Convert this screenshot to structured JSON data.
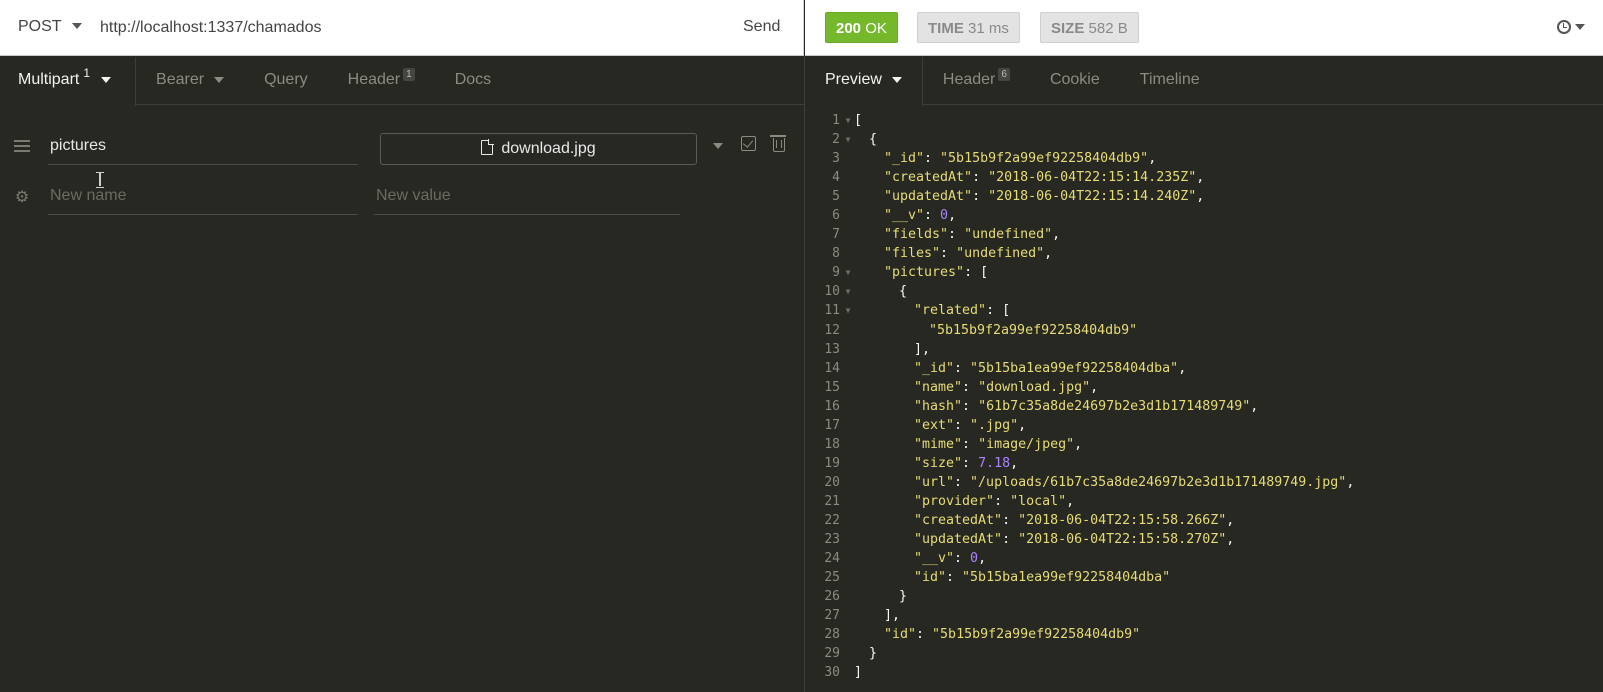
{
  "request": {
    "method": "POST",
    "url": "http://localhost:1337/chamados",
    "send_label": "Send"
  },
  "response_status": {
    "status_code": "200",
    "status_text": "OK",
    "time_label": "TIME",
    "time_value": "31 ms",
    "size_label": "SIZE",
    "size_value": "582 B"
  },
  "left_tabs": [
    {
      "label": "Multipart",
      "badge": "1",
      "active": true
    },
    {
      "label": "Bearer",
      "badge": "",
      "active": false
    },
    {
      "label": "Query",
      "badge": "",
      "active": false
    },
    {
      "label": "Header",
      "badge": "1",
      "active": false
    },
    {
      "label": "Docs",
      "badge": "",
      "active": false
    }
  ],
  "right_tabs": [
    {
      "label": "Preview",
      "badge": "",
      "active": true
    },
    {
      "label": "Header",
      "badge": "6",
      "active": false
    },
    {
      "label": "Cookie",
      "badge": "",
      "active": false
    },
    {
      "label": "Timeline",
      "badge": "",
      "active": false
    }
  ],
  "multipart": {
    "field_name": "pictures",
    "file_name": "download.jpg",
    "new_name_placeholder": "New name",
    "new_value_placeholder": "New value"
  },
  "colors": {
    "ok_green": "#75b82c",
    "editor_bg": "#272822",
    "json_string": "#e6db74",
    "json_number": "#ae81ff"
  },
  "response_lines": [
    {
      "n": "1",
      "fold": true,
      "indent": 0,
      "parts": [
        [
          "p",
          "["
        ]
      ]
    },
    {
      "n": "2",
      "fold": true,
      "indent": 1,
      "parts": [
        [
          "p",
          "{"
        ]
      ]
    },
    {
      "n": "3",
      "fold": false,
      "indent": 2,
      "parts": [
        [
          "k",
          "\"_id\""
        ],
        [
          "p",
          ": "
        ],
        [
          "s",
          "\"5b15b9f2a99ef92258404db9\""
        ],
        [
          "p",
          ","
        ]
      ]
    },
    {
      "n": "4",
      "fold": false,
      "indent": 2,
      "parts": [
        [
          "k",
          "\"createdAt\""
        ],
        [
          "p",
          ": "
        ],
        [
          "s",
          "\"2018-06-04T22:15:14.235Z\""
        ],
        [
          "p",
          ","
        ]
      ]
    },
    {
      "n": "5",
      "fold": false,
      "indent": 2,
      "parts": [
        [
          "k",
          "\"updatedAt\""
        ],
        [
          "p",
          ": "
        ],
        [
          "s",
          "\"2018-06-04T22:15:14.240Z\""
        ],
        [
          "p",
          ","
        ]
      ]
    },
    {
      "n": "6",
      "fold": false,
      "indent": 2,
      "parts": [
        [
          "k",
          "\"__v\""
        ],
        [
          "p",
          ": "
        ],
        [
          "n",
          "0"
        ],
        [
          "p",
          ","
        ]
      ]
    },
    {
      "n": "7",
      "fold": false,
      "indent": 2,
      "parts": [
        [
          "k",
          "\"fields\""
        ],
        [
          "p",
          ": "
        ],
        [
          "s",
          "\"undefined\""
        ],
        [
          "p",
          ","
        ]
      ]
    },
    {
      "n": "8",
      "fold": false,
      "indent": 2,
      "parts": [
        [
          "k",
          "\"files\""
        ],
        [
          "p",
          ": "
        ],
        [
          "s",
          "\"undefined\""
        ],
        [
          "p",
          ","
        ]
      ]
    },
    {
      "n": "9",
      "fold": true,
      "indent": 2,
      "parts": [
        [
          "k",
          "\"pictures\""
        ],
        [
          "p",
          ": ["
        ]
      ]
    },
    {
      "n": "10",
      "fold": true,
      "indent": 3,
      "parts": [
        [
          "p",
          "{"
        ]
      ]
    },
    {
      "n": "11",
      "fold": true,
      "indent": 4,
      "parts": [
        [
          "k",
          "\"related\""
        ],
        [
          "p",
          ": ["
        ]
      ]
    },
    {
      "n": "12",
      "fold": false,
      "indent": 5,
      "parts": [
        [
          "s",
          "\"5b15b9f2a99ef92258404db9\""
        ]
      ]
    },
    {
      "n": "13",
      "fold": false,
      "indent": 4,
      "parts": [
        [
          "p",
          "],"
        ]
      ]
    },
    {
      "n": "14",
      "fold": false,
      "indent": 4,
      "parts": [
        [
          "k",
          "\"_id\""
        ],
        [
          "p",
          ": "
        ],
        [
          "s",
          "\"5b15ba1ea99ef92258404dba\""
        ],
        [
          "p",
          ","
        ]
      ]
    },
    {
      "n": "15",
      "fold": false,
      "indent": 4,
      "parts": [
        [
          "k",
          "\"name\""
        ],
        [
          "p",
          ": "
        ],
        [
          "s",
          "\"download.jpg\""
        ],
        [
          "p",
          ","
        ]
      ]
    },
    {
      "n": "16",
      "fold": false,
      "indent": 4,
      "parts": [
        [
          "k",
          "\"hash\""
        ],
        [
          "p",
          ": "
        ],
        [
          "s",
          "\"61b7c35a8de24697b2e3d1b171489749\""
        ],
        [
          "p",
          ","
        ]
      ]
    },
    {
      "n": "17",
      "fold": false,
      "indent": 4,
      "parts": [
        [
          "k",
          "\"ext\""
        ],
        [
          "p",
          ": "
        ],
        [
          "s",
          "\".jpg\""
        ],
        [
          "p",
          ","
        ]
      ]
    },
    {
      "n": "18",
      "fold": false,
      "indent": 4,
      "parts": [
        [
          "k",
          "\"mime\""
        ],
        [
          "p",
          ": "
        ],
        [
          "s",
          "\"image/jpeg\""
        ],
        [
          "p",
          ","
        ]
      ]
    },
    {
      "n": "19",
      "fold": false,
      "indent": 4,
      "parts": [
        [
          "k",
          "\"size\""
        ],
        [
          "p",
          ": "
        ],
        [
          "n",
          "7.18"
        ],
        [
          "p",
          ","
        ]
      ]
    },
    {
      "n": "20",
      "fold": false,
      "indent": 4,
      "parts": [
        [
          "k",
          "\"url\""
        ],
        [
          "p",
          ": "
        ],
        [
          "s",
          "\"/uploads/61b7c35a8de24697b2e3d1b171489749.jpg\""
        ],
        [
          "p",
          ","
        ]
      ]
    },
    {
      "n": "21",
      "fold": false,
      "indent": 4,
      "parts": [
        [
          "k",
          "\"provider\""
        ],
        [
          "p",
          ": "
        ],
        [
          "s",
          "\"local\""
        ],
        [
          "p",
          ","
        ]
      ]
    },
    {
      "n": "22",
      "fold": false,
      "indent": 4,
      "parts": [
        [
          "k",
          "\"createdAt\""
        ],
        [
          "p",
          ": "
        ],
        [
          "s",
          "\"2018-06-04T22:15:58.266Z\""
        ],
        [
          "p",
          ","
        ]
      ]
    },
    {
      "n": "23",
      "fold": false,
      "indent": 4,
      "parts": [
        [
          "k",
          "\"updatedAt\""
        ],
        [
          "p",
          ": "
        ],
        [
          "s",
          "\"2018-06-04T22:15:58.270Z\""
        ],
        [
          "p",
          ","
        ]
      ]
    },
    {
      "n": "24",
      "fold": false,
      "indent": 4,
      "parts": [
        [
          "k",
          "\"__v\""
        ],
        [
          "p",
          ": "
        ],
        [
          "n",
          "0"
        ],
        [
          "p",
          ","
        ]
      ]
    },
    {
      "n": "25",
      "fold": false,
      "indent": 4,
      "parts": [
        [
          "k",
          "\"id\""
        ],
        [
          "p",
          ": "
        ],
        [
          "s",
          "\"5b15ba1ea99ef92258404dba\""
        ]
      ]
    },
    {
      "n": "26",
      "fold": false,
      "indent": 3,
      "parts": [
        [
          "p",
          "}"
        ]
      ]
    },
    {
      "n": "27",
      "fold": false,
      "indent": 2,
      "parts": [
        [
          "p",
          "],"
        ]
      ]
    },
    {
      "n": "28",
      "fold": false,
      "indent": 2,
      "parts": [
        [
          "k",
          "\"id\""
        ],
        [
          "p",
          ": "
        ],
        [
          "s",
          "\"5b15b9f2a99ef92258404db9\""
        ]
      ]
    },
    {
      "n": "29",
      "fold": false,
      "indent": 1,
      "parts": [
        [
          "p",
          "}"
        ]
      ]
    },
    {
      "n": "30",
      "fold": false,
      "indent": 0,
      "parts": [
        [
          "p",
          "]"
        ]
      ]
    }
  ]
}
